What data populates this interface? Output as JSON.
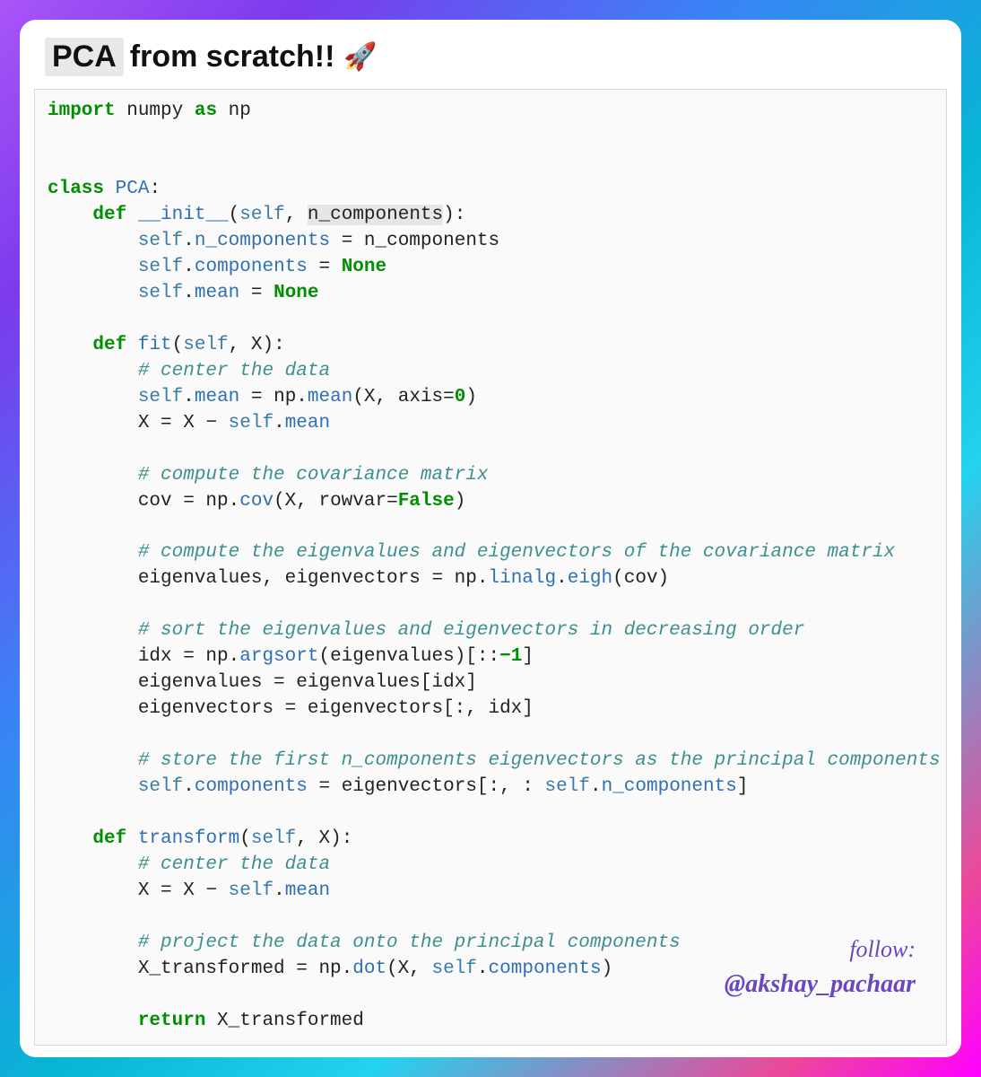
{
  "header": {
    "title_highlight": "PCA",
    "title_rest": " from scratch!!",
    "emoji": "🚀"
  },
  "code": {
    "l01_import": "import",
    "l01_numpy": " numpy ",
    "l01_as": "as",
    "l01_np": " np",
    "l04_class": "class ",
    "l04_pca": "PCA",
    "l04_colon": ":",
    "l05_def": "    def ",
    "l05_init": "__init__",
    "l05_p1": "(",
    "l05_self": "self",
    "l05_c": ", ",
    "l05_nc": "n_components",
    "l05_p2": "):",
    "l06_pre": "        ",
    "l06_self": "self",
    "l06_dot": ".",
    "l06_nc": "n_components",
    "l06_eq": " = n_components",
    "l07_pre": "        ",
    "l07_self": "self",
    "l07_dot": ".",
    "l07_comp": "components",
    "l07_eq": " = ",
    "l07_none": "None",
    "l08_pre": "        ",
    "l08_self": "self",
    "l08_dot": ".",
    "l08_mean": "mean",
    "l08_eq": " = ",
    "l08_none": "None",
    "l10_def": "    def ",
    "l10_fit": "fit",
    "l10_p1": "(",
    "l10_self": "self",
    "l10_rest": ", X):",
    "l11_cmt": "        # center the data",
    "l12_pre": "        ",
    "l12_self": "self",
    "l12_dot": ".",
    "l12_mean": "mean",
    "l12_eq": " = np.",
    "l12_meanfn": "mean",
    "l12_args": "(X, axis=",
    "l12_zero": "0",
    "l12_close": ")",
    "l13_pre": "        X = X ",
    "l13_minus": "−",
    "l13_sp": " ",
    "l13_self": "self",
    "l13_dot": ".",
    "l13_mean": "mean",
    "l15_cmt": "        # compute the covariance matrix",
    "l16_pre": "        cov = np.",
    "l16_cov": "cov",
    "l16_args": "(X, rowvar=",
    "l16_false": "False",
    "l16_close": ")",
    "l18_cmt": "        # compute the eigenvalues and eigenvectors of the covariance matrix",
    "l19_pre": "        eigenvalues, eigenvectors = np.",
    "l19_linalg": "linalg",
    "l19_dot": ".",
    "l19_eigh": "eigh",
    "l19_args": "(cov)",
    "l21_cmt": "        # sort the eigenvalues and eigenvectors in decreasing order",
    "l22_pre": "        idx = np.",
    "l22_argsort": "argsort",
    "l22_args": "(eigenvalues)[::",
    "l22_neg1": "−1",
    "l22_close": "]",
    "l23": "        eigenvalues = eigenvalues[idx]",
    "l24": "        eigenvectors = eigenvectors[:, idx]",
    "l26_cmt": "        # store the first n_components eigenvectors as the principal components",
    "l27_pre": "        ",
    "l27_self": "self",
    "l27_dot": ".",
    "l27_comp": "components",
    "l27_eq": " = eigenvectors[:, : ",
    "l27_self2": "self",
    "l27_dot2": ".",
    "l27_nc": "n_components",
    "l27_close": "]",
    "l29_def": "    def ",
    "l29_tr": "transform",
    "l29_p1": "(",
    "l29_self": "self",
    "l29_rest": ", X):",
    "l30_cmt": "        # center the data",
    "l31_pre": "        X = X ",
    "l31_minus": "−",
    "l31_sp": " ",
    "l31_self": "self",
    "l31_dot": ".",
    "l31_mean": "mean",
    "l33_cmt": "        # project the data onto the principal components",
    "l34_pre": "        X_transformed = np.",
    "l34_dot": "dot",
    "l34_args": "(X, ",
    "l34_self": "self",
    "l34_d": ".",
    "l34_comp": "components",
    "l34_close": ")",
    "l36_ret": "        return",
    "l36_rest": " X_transformed"
  },
  "follow": {
    "label": "follow:",
    "handle": "@akshay_pachaar"
  }
}
